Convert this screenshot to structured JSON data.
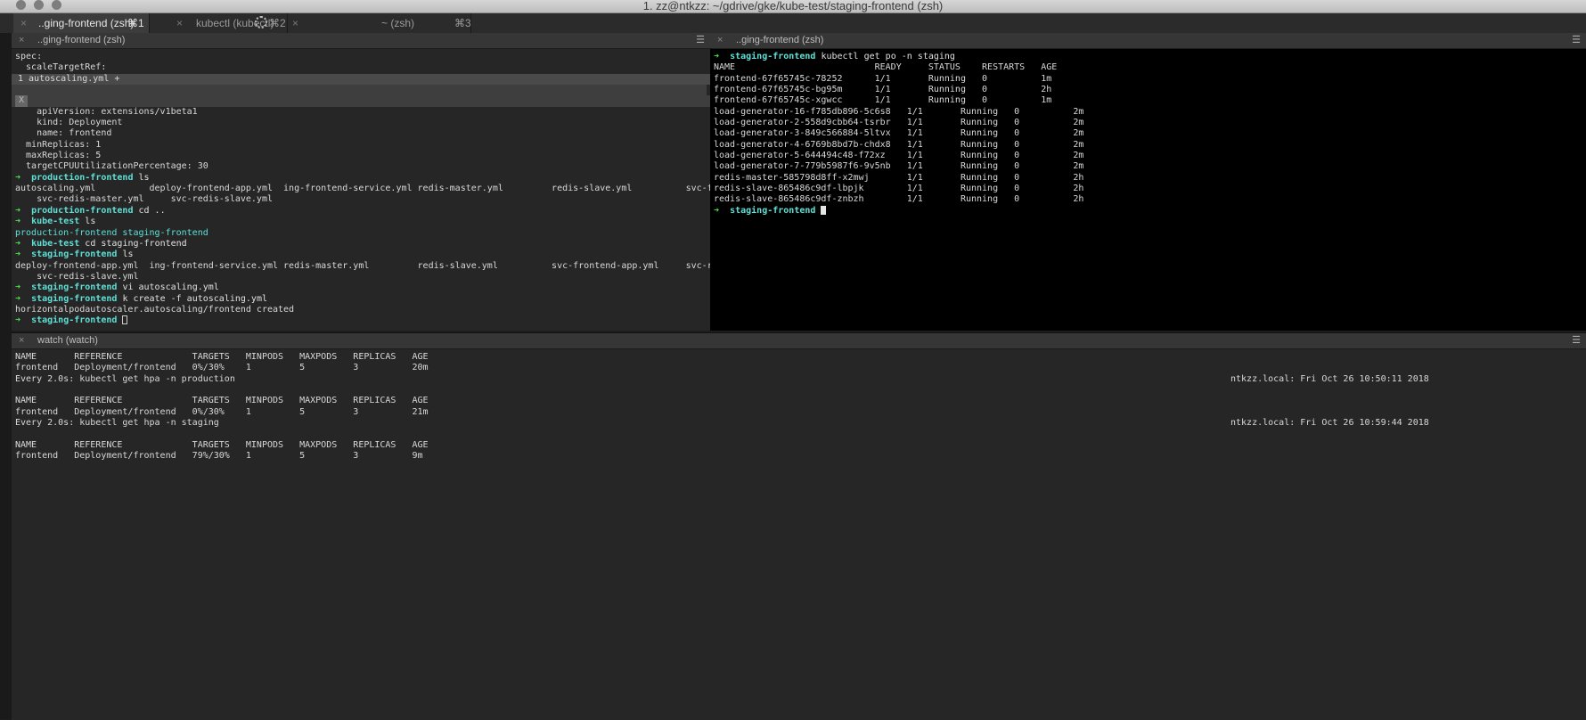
{
  "window": {
    "title": "1. zz@ntkzz: ~/gdrive/gke/kube-test/staging-frontend (zsh)"
  },
  "tabs": [
    {
      "label": "..ging-frontend (zsh)",
      "shortcut": "⌘1",
      "active": true
    },
    {
      "label": "kubectl (kubectl)",
      "shortcut": "⌘2",
      "active": false,
      "busy": true
    },
    {
      "label": "~ (zsh)",
      "shortcut": "⌘3",
      "active": false
    }
  ],
  "panes": {
    "left": {
      "title": "..ging-frontend (zsh)",
      "lines": [
        {
          "t": "text",
          "text": "spec:"
        },
        {
          "t": "text",
          "text": "  scaleTargetRef:"
        },
        {
          "t": "vimbar",
          "text": "1 autoscaling.yml +"
        },
        {
          "t": "vimblank",
          "text": ""
        },
        {
          "t": "vimx",
          "text": "X"
        },
        {
          "t": "text",
          "text": "    apiVersion: extensions/v1beta1"
        },
        {
          "t": "text",
          "text": "    kind: Deployment"
        },
        {
          "t": "text",
          "text": "    name: frontend"
        },
        {
          "t": "text",
          "text": "  minReplicas: 1"
        },
        {
          "t": "text",
          "text": "  maxReplicas: 5"
        },
        {
          "t": "text",
          "text": "  targetCPUUtilizationPercentage: 30"
        },
        {
          "t": "prompt",
          "dir": "production-frontend",
          "cmd": "ls"
        },
        {
          "t": "text",
          "text": "autoscaling.yml          deploy-frontend-app.yml  ing-frontend-service.yml redis-master.yml         redis-slave.yml          svc-frontend-app.yml"
        },
        {
          "t": "text",
          "text": "    svc-redis-master.yml     svc-redis-slave.yml"
        },
        {
          "t": "prompt",
          "dir": "production-frontend",
          "cmd": "cd .."
        },
        {
          "t": "prompt",
          "dir": "kube-test",
          "cmd": "ls"
        },
        {
          "t": "cyan",
          "text": "production-frontend staging-frontend"
        },
        {
          "t": "prompt",
          "dir": "kube-test",
          "cmd": "cd staging-frontend"
        },
        {
          "t": "prompt",
          "dir": "staging-frontend",
          "cmd": "ls"
        },
        {
          "t": "text",
          "text": "deploy-frontend-app.yml  ing-frontend-service.yml redis-master.yml         redis-slave.yml          svc-frontend-app.yml     svc-redis-master.yml"
        },
        {
          "t": "text",
          "text": "    svc-redis-slave.yml"
        },
        {
          "t": "prompt",
          "dir": "staging-frontend",
          "cmd": "vi autoscaling.yml"
        },
        {
          "t": "prompt",
          "dir": "staging-frontend",
          "cmd": "k create -f autoscaling.yml"
        },
        {
          "t": "text",
          "text": "horizontalpodautoscaler.autoscaling/frontend created"
        },
        {
          "t": "prompt",
          "dir": "staging-frontend",
          "cmd": "",
          "cursor": "hollow"
        }
      ]
    },
    "right": {
      "title": "..ging-frontend (zsh)",
      "lines": [
        {
          "t": "prompt",
          "dir": "staging-frontend",
          "cmd": "kubectl get po -n staging"
        },
        {
          "t": "text",
          "text": "NAME                          READY     STATUS    RESTARTS   AGE"
        },
        {
          "t": "text",
          "text": "frontend-67f65745c-78252      1/1       Running   0          1m"
        },
        {
          "t": "text",
          "text": "frontend-67f65745c-bg95m      1/1       Running   0          2h"
        },
        {
          "t": "text",
          "text": "frontend-67f65745c-xgwcc      1/1       Running   0          1m"
        },
        {
          "t": "text",
          "text": "load-generator-16-f785db896-5c6s8   1/1       Running   0          2m"
        },
        {
          "t": "text",
          "text": "load-generator-2-558d9cbb64-tsrbr   1/1       Running   0          2m"
        },
        {
          "t": "text",
          "text": "load-generator-3-849c566884-5ltvx   1/1       Running   0          2m"
        },
        {
          "t": "text",
          "text": "load-generator-4-6769b8bd7b-chdx8   1/1       Running   0          2m"
        },
        {
          "t": "text",
          "text": "load-generator-5-644494c48-f72xz    1/1       Running   0          2m"
        },
        {
          "t": "text",
          "text": "load-generator-7-779b5987f6-9v5nb   1/1       Running   0          2m"
        },
        {
          "t": "text",
          "text": "redis-master-585798d8ff-x2mwj       1/1       Running   0          2h"
        },
        {
          "t": "text",
          "text": "redis-slave-865486c9df-lbpjk        1/1       Running   0          2h"
        },
        {
          "t": "text",
          "text": "redis-slave-865486c9df-znbzh        1/1       Running   0          2h"
        },
        {
          "t": "prompt",
          "dir": "staging-frontend",
          "cmd": "",
          "cursor": "solid"
        }
      ]
    },
    "bottom": {
      "title": "watch (watch)",
      "lines": [
        {
          "t": "text",
          "text": "NAME       REFERENCE             TARGETS   MINPODS   MAXPODS   REPLICAS   AGE"
        },
        {
          "t": "text",
          "text": "frontend   Deployment/frontend   0%/30%    1         5         3          20m"
        },
        {
          "t": "split",
          "left": "Every 2.0s: kubectl get hpa -n production",
          "right": "ntkzz.local: Fri Oct 26 10:50:11 2018"
        },
        {
          "t": "text",
          "text": ""
        },
        {
          "t": "text",
          "text": "NAME       REFERENCE             TARGETS   MINPODS   MAXPODS   REPLICAS   AGE"
        },
        {
          "t": "text",
          "text": "frontend   Deployment/frontend   0%/30%    1         5         3          21m"
        },
        {
          "t": "split",
          "left": "Every 2.0s: kubectl get hpa -n staging",
          "right": "ntkzz.local: Fri Oct 26 10:59:44 2018"
        },
        {
          "t": "text",
          "text": ""
        },
        {
          "t": "text",
          "text": "NAME       REFERENCE             TARGETS   MINPODS   MAXPODS   REPLICAS   AGE"
        },
        {
          "t": "text",
          "text": "frontend   Deployment/frontend   79%/30%   1         5         3          9m"
        }
      ]
    }
  },
  "icons": {
    "close": "×",
    "menu": "☰",
    "prompt_arrow": "➜"
  },
  "colors": {
    "prompt_arrow": "#4be04b",
    "prompt_dir": "#5ee0d6",
    "background": "#1d1d1d"
  }
}
